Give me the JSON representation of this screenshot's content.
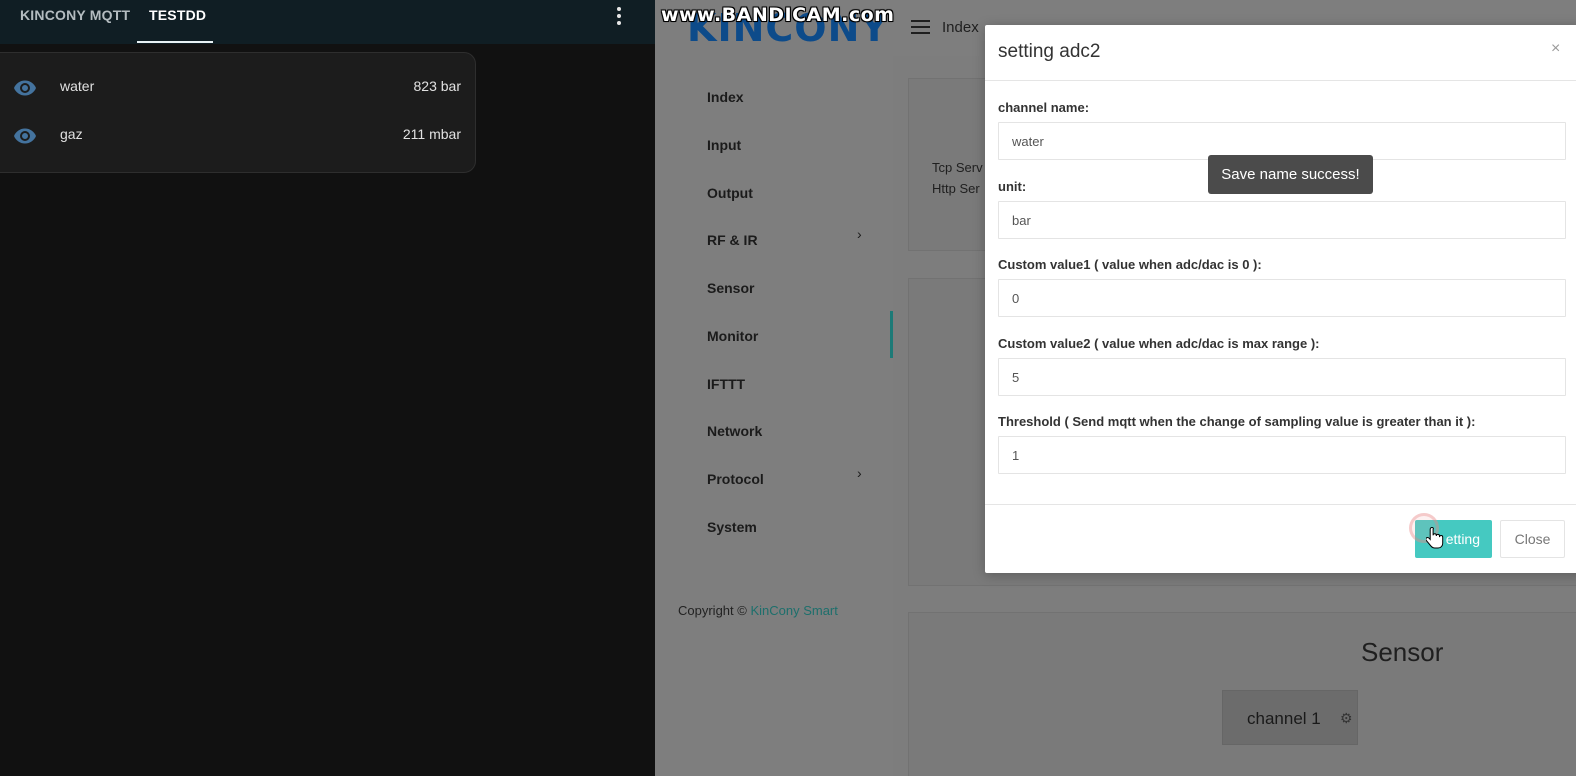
{
  "ha": {
    "tabs": [
      {
        "label": "KINCONY MQTT",
        "active": false
      },
      {
        "label": "TESTDD",
        "active": true
      }
    ],
    "menu_icon": "dots-vertical-icon",
    "entities": [
      {
        "icon": "eye-icon",
        "name": "water",
        "value": "823 bar"
      },
      {
        "icon": "eye-icon",
        "name": "gaz",
        "value": "211 mbar"
      }
    ],
    "colors": {
      "header_bg": "#101e24",
      "icon": "#44739e"
    }
  },
  "kincony": {
    "logo": "KINCONY",
    "nav": [
      {
        "label": "Index",
        "has_submenu": false,
        "active": false
      },
      {
        "label": "Input",
        "has_submenu": false,
        "active": false
      },
      {
        "label": "Output",
        "has_submenu": false,
        "active": false
      },
      {
        "label": "RF & IR",
        "has_submenu": true,
        "active": false
      },
      {
        "label": "Sensor",
        "has_submenu": false,
        "active": false
      },
      {
        "label": "Monitor",
        "has_submenu": false,
        "active": true
      },
      {
        "label": "IFTTT",
        "has_submenu": false,
        "active": false
      },
      {
        "label": "Network",
        "has_submenu": false,
        "active": false
      },
      {
        "label": "Protocol",
        "has_submenu": true,
        "active": false
      },
      {
        "label": "System",
        "has_submenu": false,
        "active": false
      }
    ],
    "chevron": "›",
    "copyright_prefix": "Copyright ©",
    "copyright_link": "KinCony Smart",
    "topbar": {
      "menu_icon": "hamburger-icon",
      "breadcrumb": "Index"
    },
    "server_lines": [
      "Tcp Serv",
      "Http Ser"
    ],
    "sensor_section": {
      "title": "Sensor",
      "channel_label": "channel 1",
      "channel_icon": "gear-icon",
      "gear_glyph": "⚙"
    },
    "accent_color": "#1d7a77"
  },
  "modal": {
    "title": "setting adc2",
    "close_glyph": "×",
    "fields": [
      {
        "label": "channel name:",
        "value": "water"
      },
      {
        "label": "unit:",
        "value": "bar"
      },
      {
        "label": "Custom value1 ( value when adc/dac is 0 ):",
        "value": "0"
      },
      {
        "label": "Custom value2 ( value when adc/dac is max range ):",
        "value": "5"
      },
      {
        "label": "Threshold ( Send mqtt when the change of sampling value is greater than it ):",
        "value": "1"
      }
    ],
    "setting_button": "etting",
    "close_button": "Close",
    "button_color": "#45c9c1"
  },
  "toast": {
    "message": "Save name success!"
  },
  "watermark": "www.BANDICAM.com"
}
